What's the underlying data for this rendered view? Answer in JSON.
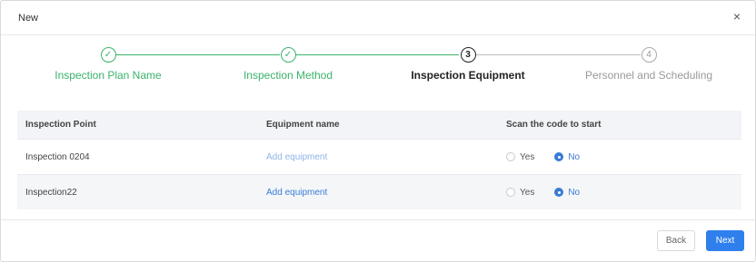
{
  "dialog": {
    "title": "New",
    "close_glyph": "×"
  },
  "steps": [
    {
      "label": "Inspection Plan Name",
      "marker": "✓",
      "state": "done"
    },
    {
      "label": "Inspection Method",
      "marker": "✓",
      "state": "done"
    },
    {
      "label": "Inspection Equipment",
      "marker": "3",
      "state": "active"
    },
    {
      "label": "Personnel and Scheduling",
      "marker": "4",
      "state": "pending"
    }
  ],
  "table": {
    "headers": [
      "Inspection Point",
      "Equipment name",
      "Scan the code to start"
    ],
    "rows": [
      {
        "point": "Inspection 0204",
        "equipment": "Add equipment",
        "yes": "Yes",
        "no": "No",
        "selected": "No"
      },
      {
        "point": "Inspection22",
        "equipment": "Add equipment",
        "yes": "Yes",
        "no": "No",
        "selected": "No"
      }
    ]
  },
  "footer": {
    "back_label": "Back",
    "next_label": "Next"
  },
  "colors": {
    "accent": "#2f80ed",
    "done": "#3bb36a",
    "pending": "#999999"
  }
}
